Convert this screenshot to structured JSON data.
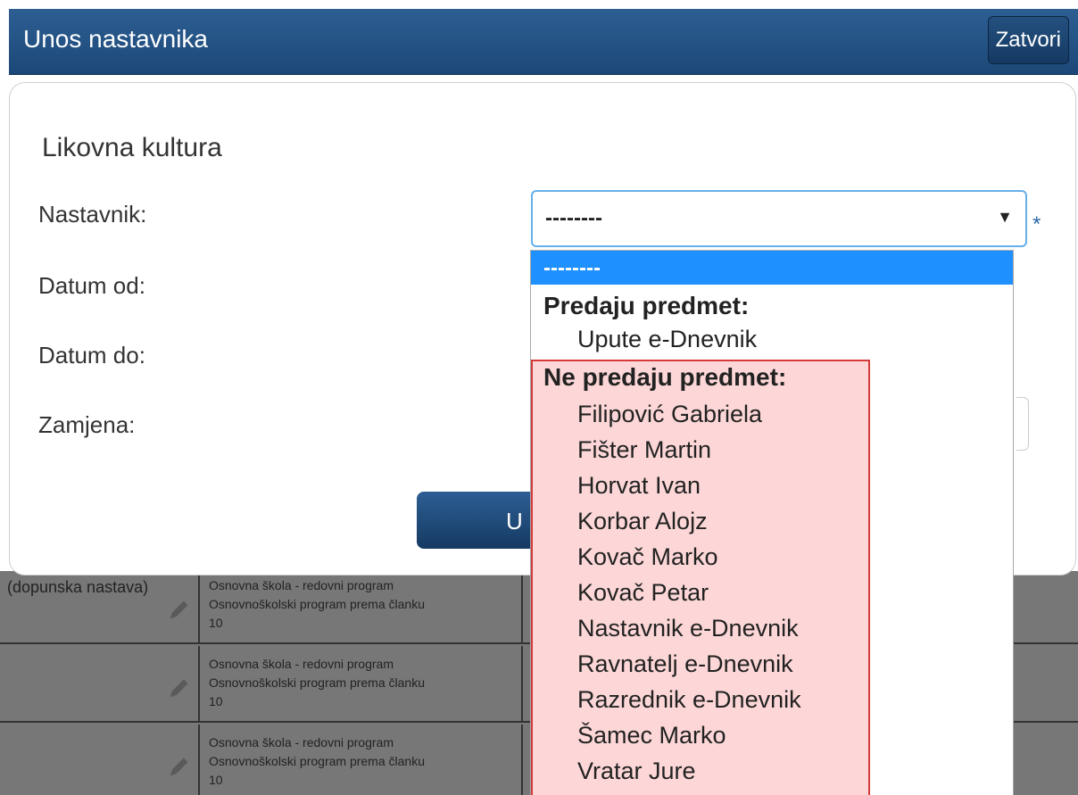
{
  "header": {
    "title": "Unos nastavnika",
    "close_label": "Zatvori"
  },
  "form": {
    "subject": "Likovna kultura",
    "labels": [
      "Nastavnik:",
      "Datum od:",
      "Datum do:",
      "Zamjena:"
    ],
    "teacher_select_value": "--------",
    "required_mark": "*",
    "submit_label_partial": "U"
  },
  "dropdown": {
    "selected": "--------",
    "groups": [
      {
        "label": "Predaju predmet:",
        "options": [
          "Upute e-Dnevnik"
        ]
      },
      {
        "label": "Ne predaju predmet:",
        "options": [
          "Filipović Gabriela",
          "Fišter Martin",
          "Horvat Ivan",
          "Korbar Alojz",
          "Kovač Marko",
          "Kovač Petar",
          "Nastavnik e-Dnevnik",
          "Ravnatelj e-Dnevnik",
          "Razrednik e-Dnevnik",
          "Šamec Marko",
          "Vratar Jure"
        ]
      }
    ]
  },
  "background_table": {
    "rows": [
      {
        "label": "(dopunska nastava)",
        "program": [
          "Osnovna škola - redovni program",
          "Osnovnoškolski program prema članku",
          "10"
        ]
      },
      {
        "label": "",
        "program": [
          "Osnovna škola - redovni program",
          "Osnovnoškolski program prema članku",
          "10"
        ]
      },
      {
        "label": "",
        "program": [
          "Osnovna škola - redovni program",
          "Osnovnoškolski program prema članku",
          "10"
        ]
      }
    ]
  },
  "colors": {
    "header": "#1c4877",
    "selected_option": "#1e90ff",
    "highlight_bg": "#fdd7d7",
    "highlight_border": "#d43a3a"
  }
}
